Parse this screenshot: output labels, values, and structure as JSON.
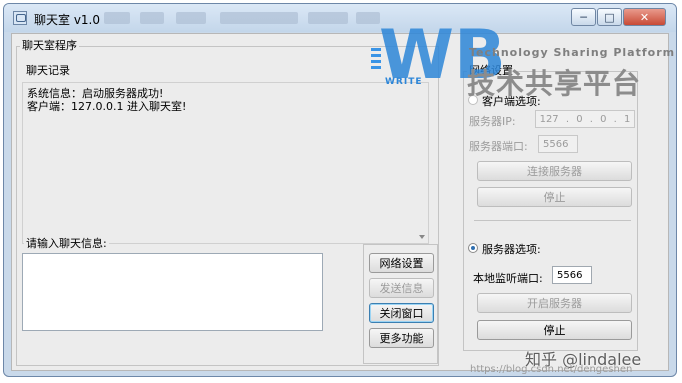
{
  "window": {
    "title": "聊天室 v1.0",
    "controls": {
      "minimize": "─",
      "maximize": "□",
      "close": "✕"
    }
  },
  "main_group": {
    "label": "聊天室程序"
  },
  "chat_log": {
    "label": "聊天记录",
    "lines": [
      "系统信息：启动服务器成功!",
      "客户端：127.0.0.1 进入聊天室!"
    ]
  },
  "message_input": {
    "label": "请输入聊天信息:",
    "value": ""
  },
  "action_buttons": {
    "network_settings": "网络设置",
    "send": "发送信息",
    "close_window": "关闭窗口",
    "more": "更多功能"
  },
  "network_group": {
    "label": "网络设置",
    "client": {
      "radio_label": "客户端选项:",
      "server_ip_label": "服务器IP:",
      "ip_octets": [
        "127",
        "0",
        "0",
        "1"
      ],
      "server_port_label": "服务器端口:",
      "server_port_value": "5566",
      "connect_button": "连接服务器",
      "stop_button": "停止"
    },
    "server": {
      "radio_label": "服务器选项:",
      "listen_port_label": "本地监听端口:",
      "listen_port_value": "5566",
      "start_button": "开启服务器",
      "stop_button": "停止"
    }
  },
  "watermark": {
    "logo_letters": "WB",
    "logo_write": "WRITE",
    "tagline": "Technology Sharing Platform",
    "cn_title": "技术共享平台",
    "zhihu": "知乎 @lindalee",
    "blog": "https://blog.csdn.net/dengeshen"
  }
}
